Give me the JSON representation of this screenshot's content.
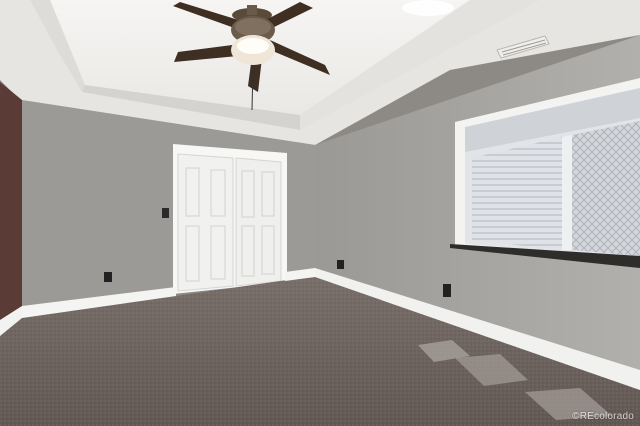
{
  "scene": {
    "room": "empty-bedroom",
    "colors": {
      "ceiling": "#f4f3f1",
      "tray_ceiling": "#ebeae7",
      "wall_left": "#9a9894",
      "wall_back": "#a3a19d",
      "wall_right": "#a7a5a1",
      "accent_wall": "#5b3b36",
      "carpet": "#6e6460",
      "trim": "#ffffff",
      "window_shade": "#d6d8db"
    },
    "objects": [
      "ceiling-fan",
      "closet-double-door",
      "window-with-blinds",
      "air-vent",
      "light-switch",
      "electrical-outlet",
      "baseboard",
      "carpet"
    ]
  },
  "watermark": {
    "text": "©REcolorado"
  }
}
